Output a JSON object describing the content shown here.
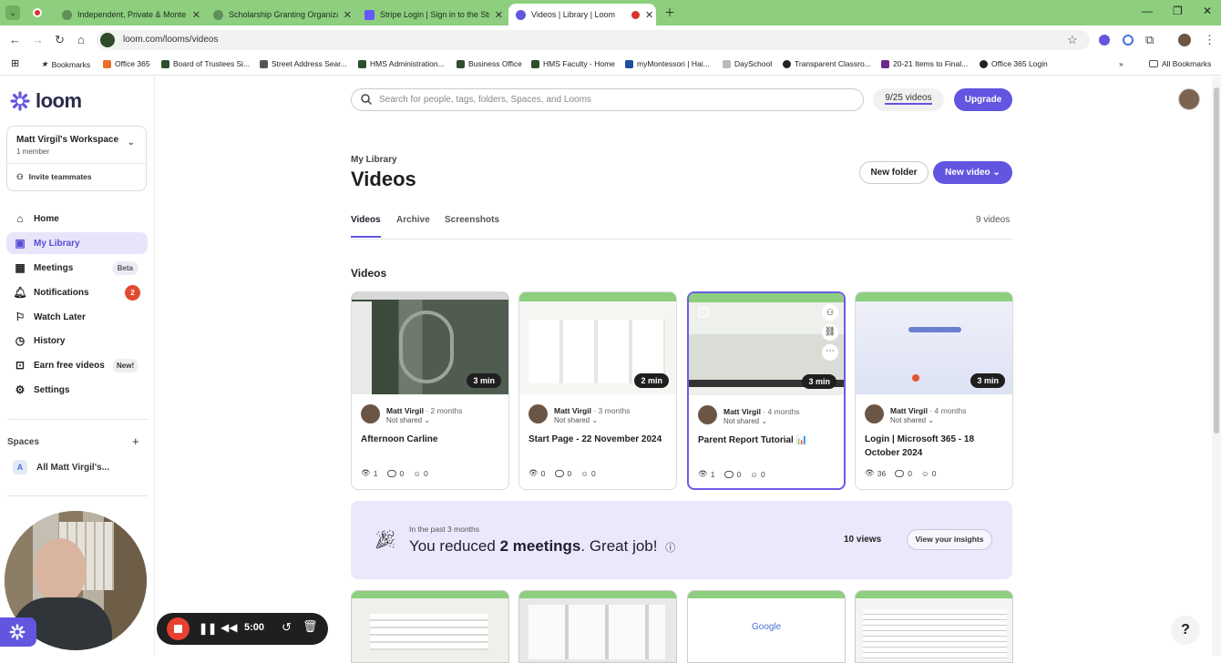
{
  "browser": {
    "tabs": [
      {
        "label": "Independent, Private & Monte"
      },
      {
        "label": "Scholarship Granting Organizat"
      },
      {
        "label": "Stripe Login | Sign in to the Stri"
      },
      {
        "label": "Videos | Library | Loom"
      }
    ],
    "url": "loom.com/looms/videos",
    "bookmarks": [
      "Bookmarks",
      "Office 365",
      "Board of Trustees Si...",
      "Street Address Sear...",
      "HMS Administration...",
      "Business Office",
      "HMS Faculty - Home",
      "myMontessori | Hai...",
      "DaySchool",
      "Transparent Classro...",
      "20-21 Items to Final...",
      "Office 365 Login"
    ],
    "all_bookmarks": "All Bookmarks"
  },
  "sidebar": {
    "logo": "loom",
    "workspace_name": "Matt Virgil's Workspace",
    "workspace_members": "1 member",
    "invite": "Invite teammates",
    "items": [
      {
        "label": "Home",
        "icon": "home-icon"
      },
      {
        "label": "My Library",
        "icon": "library-icon"
      },
      {
        "label": "Meetings",
        "icon": "calendar-icon",
        "badge": "Beta"
      },
      {
        "label": "Notifications",
        "icon": "bell-icon",
        "badge": "2"
      },
      {
        "label": "Watch Later",
        "icon": "bookmark-icon"
      },
      {
        "label": "History",
        "icon": "history-icon"
      },
      {
        "label": "Earn free videos",
        "icon": "gift-icon",
        "badge": "New!"
      },
      {
        "label": "Settings",
        "icon": "gear-icon"
      }
    ],
    "spaces_label": "Spaces",
    "space_item_letter": "A",
    "space_item": "All Matt Virgil's..."
  },
  "header": {
    "search_placeholder": "Search for people, tags, folders, Spaces, and Looms",
    "video_count": "9/25 videos",
    "upgrade": "Upgrade"
  },
  "library": {
    "breadcrumb": "My Library",
    "title": "Videos",
    "new_folder": "New folder",
    "new_video": "New video",
    "tabs": [
      "Videos",
      "Archive",
      "Screenshots"
    ],
    "count": "9 videos",
    "section": "Videos"
  },
  "cards": [
    {
      "duration": "3 min",
      "author": "Matt Virgil",
      "age": "2 months",
      "share": "Not shared",
      "title": "Afternoon Carline",
      "views": "1",
      "comments": "0",
      "reactions": "0"
    },
    {
      "duration": "2 min",
      "author": "Matt Virgil",
      "age": "3 months",
      "share": "Not shared",
      "title": "Start Page - 22 November 2024",
      "views": "0",
      "comments": "0",
      "reactions": "0"
    },
    {
      "duration": "3 min",
      "author": "Matt Virgil",
      "age": "4 months",
      "share": "Not shared",
      "title": "Parent Report Tutorial 📊",
      "views": "1",
      "comments": "0",
      "reactions": "0"
    },
    {
      "duration": "3 min",
      "author": "Matt Virgil",
      "age": "4 months",
      "share": "Not shared",
      "title": "Login | Microsoft 365 - 18 October 2024",
      "views": "36",
      "comments": "0",
      "reactions": "0"
    }
  ],
  "insight": {
    "period": "In the past 3 months",
    "message_pre": "You reduced ",
    "message_bold": "2 meetings",
    "message_post": ". Great job!",
    "views": "10 views",
    "button": "View your insights"
  },
  "recorder": {
    "time": "5:00"
  },
  "help": "?",
  "colors": {
    "accent": "#6255e0",
    "tabbar": "#8dcf7e"
  }
}
